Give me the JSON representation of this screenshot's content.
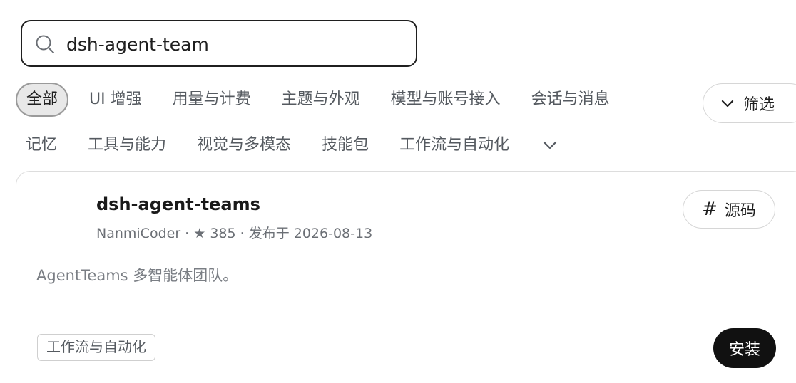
{
  "search": {
    "value": "dsh-agent-team",
    "icon": "search-icon"
  },
  "categories": {
    "row1": [
      "全部",
      "UI 增强",
      "用量与计费",
      "主题与外观",
      "模型与账号接入",
      "会话与消息"
    ],
    "row2": [
      "记忆",
      "工具与能力",
      "视觉与多模态",
      "技能包",
      "工作流与自动化"
    ],
    "active": "全部"
  },
  "filter": {
    "label": "筛选",
    "icon": "chevron-down-icon"
  },
  "card": {
    "title": "dsh-agent-teams",
    "meta": "NanmiCoder · ★ 385 · 发布于 2026-08-13",
    "description": "AgentTeams 多智能体团队。",
    "source_label": "源码",
    "source_icon": "hash-icon",
    "tag": "工作流与自动化",
    "install_label": "安装"
  }
}
